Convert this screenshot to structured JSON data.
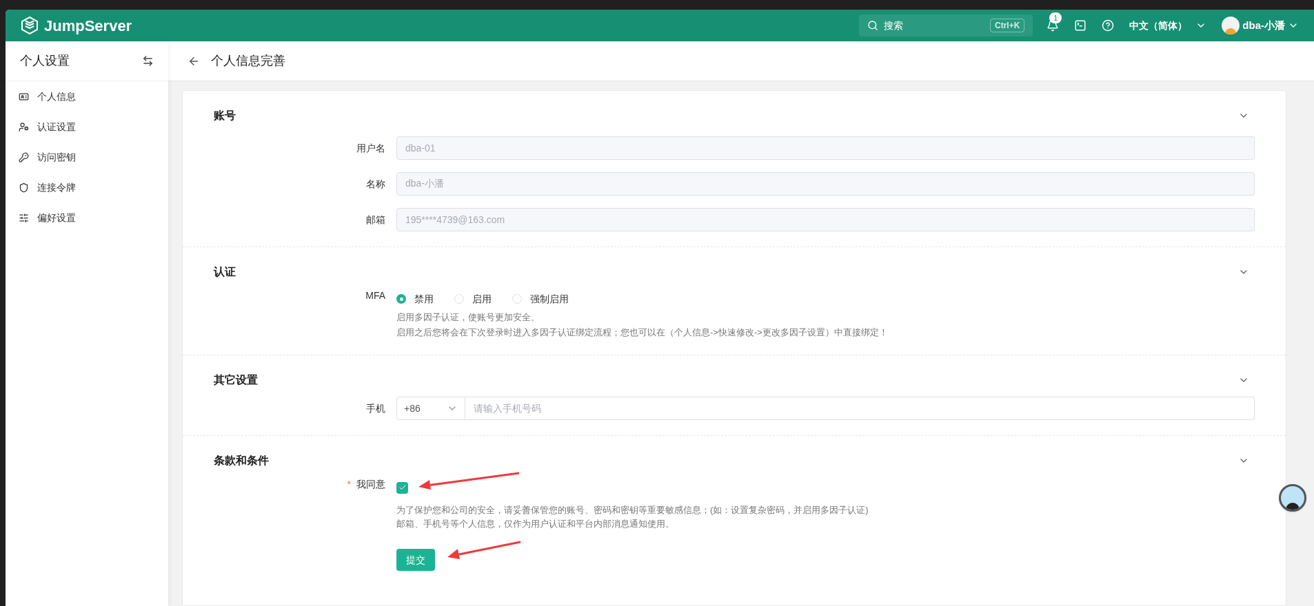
{
  "header": {
    "logo": "JumpServer",
    "search": {
      "placeholder": "搜索",
      "shortcut": "Ctrl+K"
    },
    "notifications": "1",
    "language": "中文（简体）",
    "user": "dba-小潘"
  },
  "sidebar": {
    "title": "个人设置",
    "items": [
      {
        "label": "个人信息"
      },
      {
        "label": "认证设置"
      },
      {
        "label": "访问密钥"
      },
      {
        "label": "连接令牌"
      },
      {
        "label": "偏好设置"
      }
    ]
  },
  "page": {
    "title": "个人信息完善"
  },
  "sections": [
    {
      "kind": "fields",
      "title": "账号",
      "fields": [
        {
          "label": "用户名",
          "value": "dba-01"
        },
        {
          "label": "名称",
          "value": "dba-小潘"
        },
        {
          "label": "邮箱",
          "value": "195****4739@163.com"
        }
      ]
    },
    {
      "kind": "mfa",
      "title": "认证",
      "label": "MFA",
      "options": [
        {
          "label": "禁用",
          "selected": true
        },
        {
          "label": "启用",
          "selected": false
        },
        {
          "label": "强制启用",
          "selected": false
        }
      ],
      "help": [
        "启用多因子认证，使账号更加安全。",
        "启用之后您将会在下次登录时进入多因子认证绑定流程；您也可以在（个人信息->快速修改->更改多因子设置）中直接绑定！"
      ]
    },
    {
      "kind": "phone",
      "title": "其它设置",
      "label": "手机",
      "code": "+86",
      "placeholder": "请输入手机号码"
    },
    {
      "kind": "terms",
      "title": "条款和条件",
      "required": "*",
      "label": "我同意",
      "checked": true,
      "help": [
        "为了保护您和公司的安全，请妥善保管您的账号、密码和密钥等重要敏感信息；(如：设置复杂密码，并启用多因子认证)",
        "邮箱、手机号等个人信息，仅作为用户认证和平台内部消息通知使用。"
      ],
      "submit": "提交"
    }
  ]
}
